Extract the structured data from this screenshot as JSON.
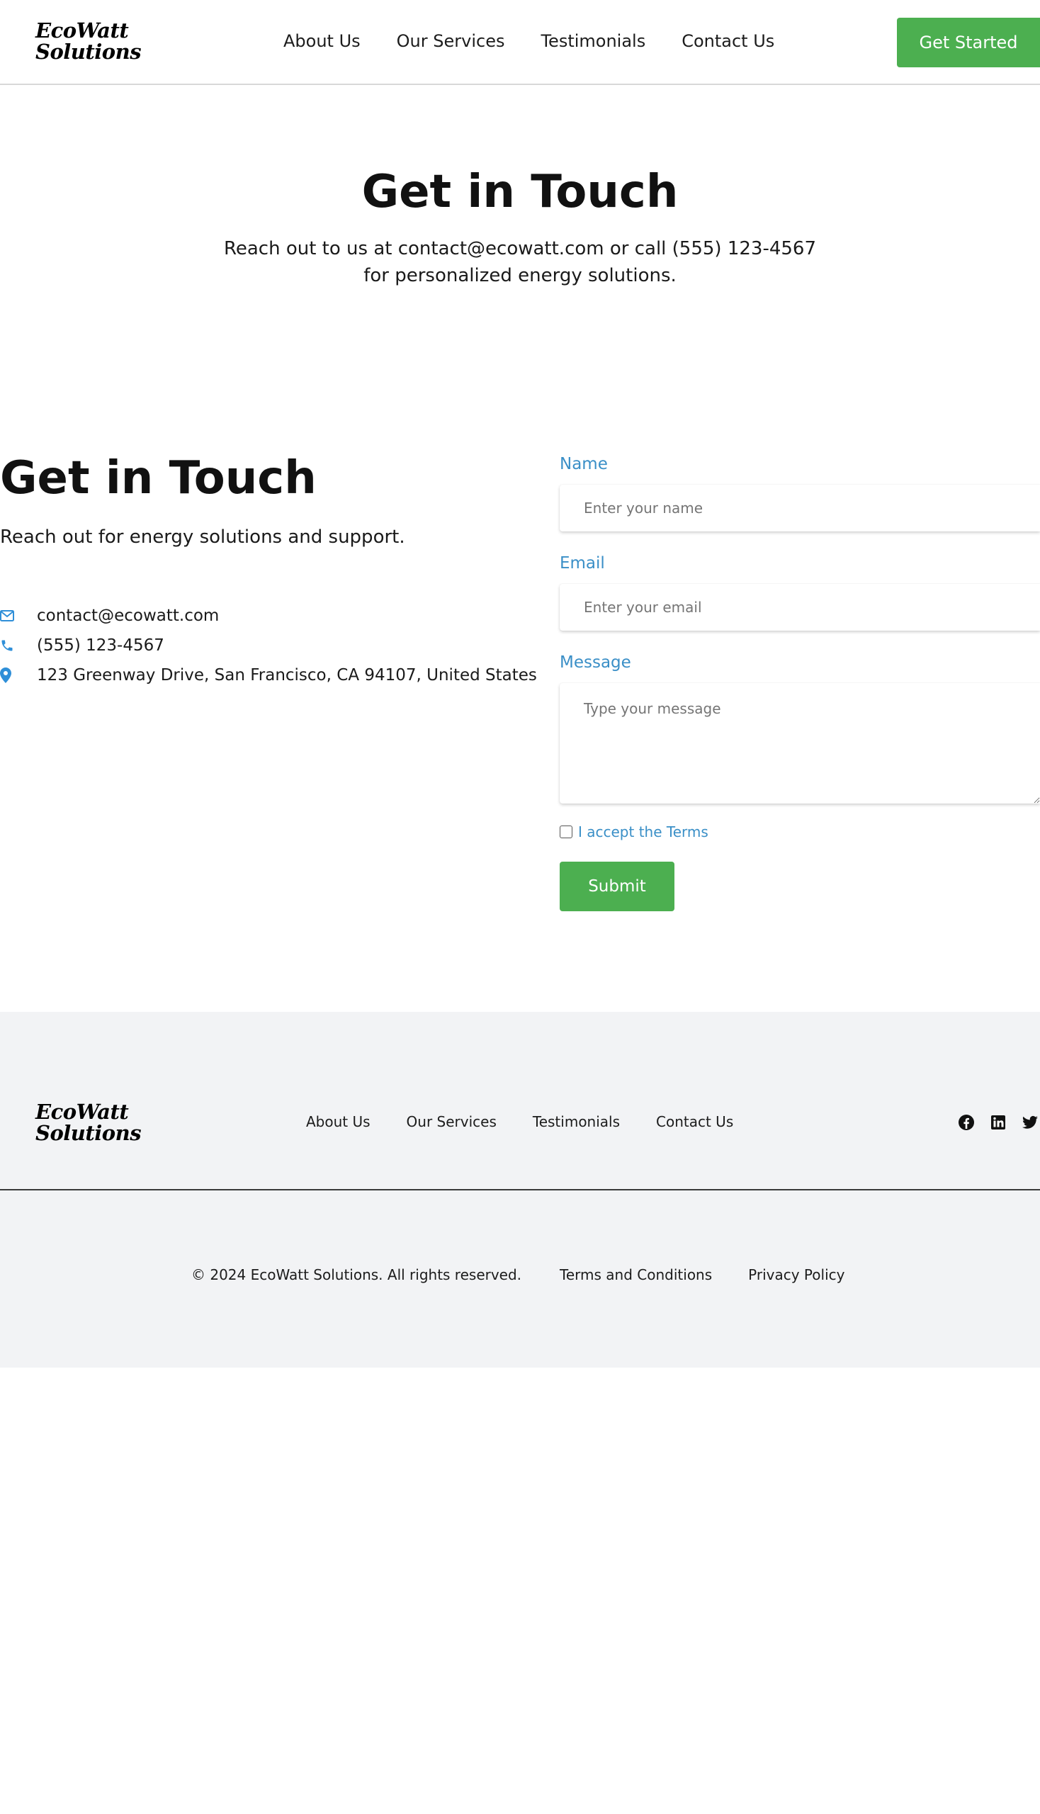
{
  "header": {
    "logo": "EcoWatt Solutions",
    "nav": [
      "About Us",
      "Our Services",
      "Testimonials",
      "Contact Us"
    ],
    "cta": "Get Started"
  },
  "hero": {
    "title": "Get in Touch",
    "subtitle": "Reach out to us at contact@ecowatt.com or call (555) 123-4567 for personalized energy solutions."
  },
  "contact": {
    "title": "Get in Touch",
    "subtitle": "Reach out for energy solutions and support.",
    "items": [
      {
        "icon": "envelope-icon",
        "text": "contact@ecowatt.com"
      },
      {
        "icon": "phone-icon",
        "text": "(555) 123-4567"
      },
      {
        "icon": "map-pin-icon",
        "text": "123 Greenway Drive, San Francisco, CA 94107, United States"
      }
    ]
  },
  "form": {
    "name_label": "Name",
    "name_placeholder": "Enter your name",
    "email_label": "Email",
    "email_placeholder": "Enter your email",
    "message_label": "Message",
    "message_placeholder": "Type your message",
    "terms_label": "I accept the Terms",
    "terms_checked": false,
    "submit": "Submit"
  },
  "footer": {
    "logo": "EcoWatt Solutions",
    "nav": [
      "About Us",
      "Our Services",
      "Testimonials",
      "Contact Us"
    ],
    "social": [
      "facebook-icon",
      "linkedin-icon",
      "twitter-icon"
    ],
    "copyright": "© 2024 EcoWatt Solutions. All rights reserved.",
    "links": [
      "Terms and Conditions",
      "Privacy Policy"
    ]
  },
  "colors": {
    "accent_green": "#4caf50",
    "label_blue": "#3a8fc7",
    "icon_blue": "#2f8fd8",
    "footer_bg": "#f2f3f5"
  }
}
